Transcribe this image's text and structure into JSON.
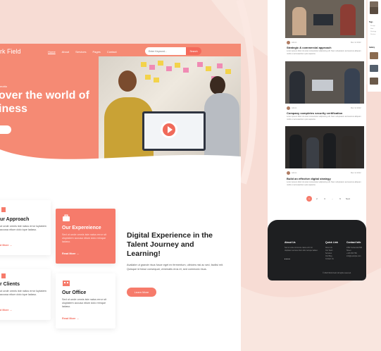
{
  "header": {
    "logo_main": "rk",
    "logo_rest": " Field",
    "nav": [
      "Home",
      "About",
      "Services",
      "Pages",
      "Contact"
    ],
    "search_placeholder": "Enter Keyword...",
    "search_button": "Search"
  },
  "hero": {
    "small_label": "motto",
    "title": "over the world of iness"
  },
  "cards": [
    {
      "title": "ur Approach",
      "text": "ut unde omnis iste natus error luptatem accusa ntium dolo ique ladaso.",
      "link": "d More →"
    },
    {
      "title": "Our Expereience",
      "text": "Sed ut unde omnis iste natus error sit oluptatem accusa ntium dolo reinque ladaso.",
      "link": "Read More →"
    },
    {
      "title": "r Clients",
      "text": "ut unde omnis iste natus error luptatem accusa ntium dolo ique ladaso.",
      "link": "d More →"
    },
    {
      "title": "Our Office",
      "text": "Sed ut unde omnis iste natus error sit oluptatem accusa ntium dolo reinque ladaso.",
      "link": "Read More →"
    }
  ],
  "feature": {
    "title": "Digital Experience in the Talent Journey and Learning!",
    "text": "Availabe ut grande risus fusce eget ex fermentum, ultricies nisi ac sed, facilisi mit. Quisque id fuisui consequat, venenatis eros et, sed commodo risus.",
    "button": "Learn More"
  },
  "blog": {
    "posts": [
      {
        "author": "Admin",
        "date": "Mar 14 2022",
        "title": "Strategic & commercial approach",
        "text": "Lorem ipsum dolor sit amet consectetur adipiscing elit. Nam voluptatem accusamus aliquam mollis ut accusantium quis sapiente."
      },
      {
        "author": "Admin",
        "date": "Mar 14 2022",
        "title": "Company completes security certification",
        "text": "Lorem ipsum dolor sit amet consectetur adipiscing elit. Nam voluptatem accusamus aliquam mollis ut accusantium quis sapiente."
      },
      {
        "author": "Admin",
        "date": "Mar 14 2022",
        "title": "Build an effective digital strategy",
        "text": "Lorem ipsum dolor sit amet consectetur adipiscing elit. Nam voluptatem accusamus aliquam mollis ut accusantium quis sapiente."
      }
    ],
    "pager": [
      "1",
      "2",
      "3",
      "...",
      "9",
      "Next"
    ]
  },
  "footer": {
    "about_title": "About Us",
    "about_text": "Sed ut unde omnis iste natus error sit oluptatem accusa ntium dolo reinque ladaso.",
    "quick_title": "Quick Link",
    "quick_links": [
      "About Us",
      "Our Team",
      "Services",
      "Our Blog",
      "Contact Us"
    ],
    "contact_title": "Contact Info",
    "contact_lines": [
      "2492 Centennial NW Street",
      "+123 456 789",
      "info@example.com"
    ],
    "copyright": "© 2022 Work Field. All rights reserved."
  },
  "sidebar": {
    "tags_label": "Tags",
    "tags": [
      "Design",
      "Idea",
      "Strategy",
      "Startup"
    ],
    "gallery_label": "Gallery"
  },
  "colors": {
    "accent": "#f67b6b",
    "dark": "#1e1f21",
    "background": "#f7dcd4"
  }
}
